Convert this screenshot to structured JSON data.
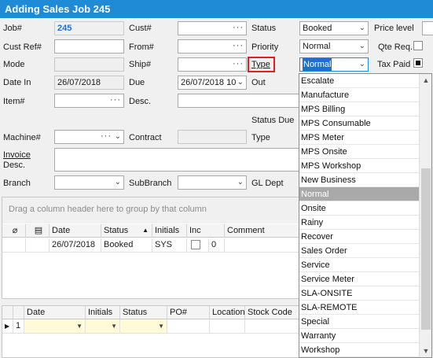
{
  "window": {
    "title": "Adding Sales Job 245"
  },
  "labels": {
    "job": "Job#",
    "cust_ref": "Cust Ref#",
    "mode": "Mode",
    "date_in": "Date In",
    "item": "Item#",
    "cust": "Cust#",
    "from": "From#",
    "ship": "Ship#",
    "due": "Due",
    "desc": "Desc.",
    "status": "Status",
    "priority": "Priority",
    "type": "Type",
    "out": "Out",
    "price_level": "Price level",
    "qte_req": "Qte Req.",
    "tax_paid": "Tax Paid",
    "status_due": "Status Due",
    "machine": "Machine#",
    "contract": "Contract",
    "type2": "Type",
    "invoice": "Invoice",
    "desc2": "Desc.",
    "branch": "Branch",
    "subbranch": "SubBranch",
    "gl_dept": "GL Dept"
  },
  "fields": {
    "job_number": "245",
    "date_in": "26/07/2018",
    "due": "26/07/2018 10",
    "status": "Booked",
    "priority": "Normal",
    "type": "Normal",
    "tax_paid_checked": true,
    "qte_req_checked": false
  },
  "activity_grid": {
    "group_hint": "Drag a column header here to group by that column",
    "columns": [
      "Date",
      "Status",
      "Initials",
      "Inc",
      "Comment"
    ],
    "row": {
      "date": "26/07/2018",
      "status": "Booked",
      "initials": "SYS",
      "inc_value": "0"
    }
  },
  "items_grid": {
    "columns": [
      "Date",
      "Initials",
      "Status",
      "PO#",
      "Location",
      "Stock Code"
    ],
    "row_number": "1"
  },
  "type_dropdown": {
    "options": [
      "Escalate",
      "Manufacture",
      "MPS Billing",
      "MPS Consumable",
      "MPS Meter",
      "MPS Onsite",
      "MPS Workshop",
      "New Business",
      "Normal",
      "Onsite",
      "Rainy",
      "Recover",
      "Sales Order",
      "Service",
      "Service Meter",
      "SLA-ONSITE",
      "SLA-REMOTE",
      "Special",
      "Warranty",
      "Workshop"
    ],
    "selected": "Normal"
  },
  "colors": {
    "titlebar": "#1f8ad6",
    "job_number": "#1f6fd1",
    "highlight_box": "#e02020",
    "selected_option": "#a9a9a9"
  }
}
